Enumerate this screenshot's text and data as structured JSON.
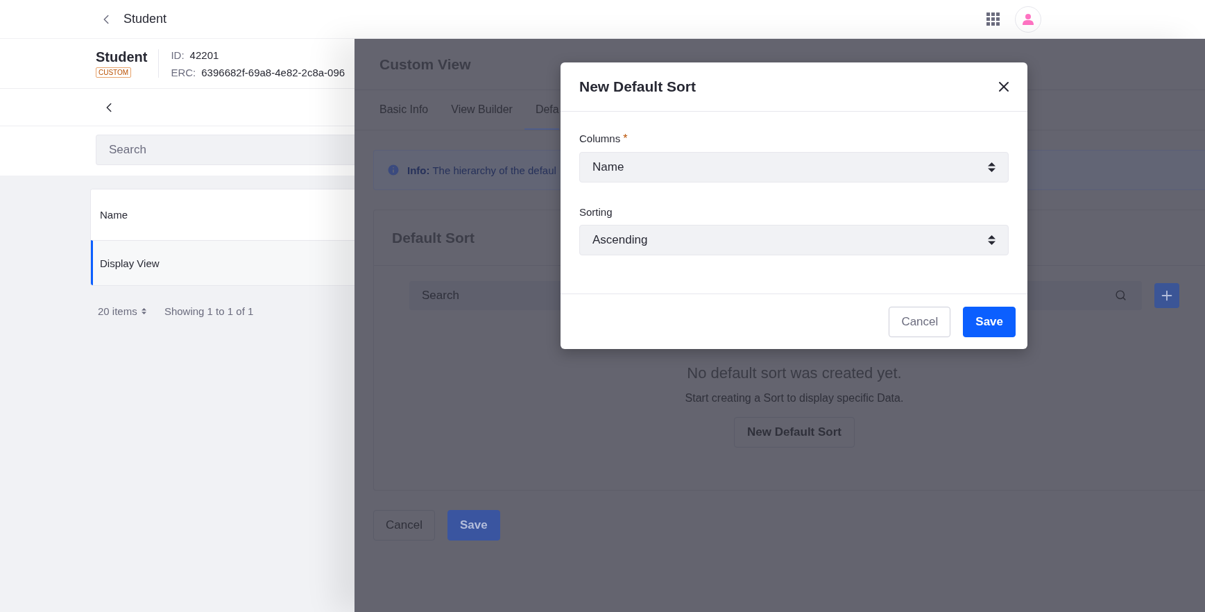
{
  "top_bar": {
    "title": "Student"
  },
  "object_header": {
    "title": "Student",
    "badge": "CUSTOM",
    "id_label": "ID:",
    "id_value": "42201",
    "erc_label": "ERC:",
    "erc_value": "6396682f-69a8-4e82-2c8a-096"
  },
  "sidebar": {
    "search": {
      "placeholder": "Search"
    },
    "rows": [
      {
        "label": "Name",
        "selected": false
      },
      {
        "label": "Display View",
        "selected": true
      }
    ],
    "pagination": {
      "page_size": "20 items",
      "summary": "Showing 1 to 1 of 1"
    }
  },
  "panel": {
    "title": "Custom View",
    "tabs": [
      {
        "label": "Basic Info",
        "selected": false
      },
      {
        "label": "View Builder",
        "selected": false
      },
      {
        "label": "Defa",
        "selected": true
      }
    ],
    "info": "**Info:** The hierarchy of the defaul",
    "card": {
      "title": "Default Sort",
      "search": {
        "placeholder": "Search"
      },
      "empty_title": "No default sort was created yet.",
      "empty_text": "Start creating a Sort to display specific Data.",
      "empty_button": "New Default Sort"
    },
    "buttons": [
      {
        "label": "Cancel",
        "kind": "secondary"
      },
      {
        "label": "Save",
        "kind": "primary"
      }
    ]
  },
  "modal": {
    "title": "New Default Sort",
    "fields": [
      {
        "label": "Columns",
        "required_mark": "*",
        "value": "Name"
      },
      {
        "label": "Sorting",
        "value": "Ascending"
      }
    ],
    "buttons": [
      {
        "label": "Cancel",
        "kind": "secondary"
      },
      {
        "label": "Save",
        "kind": "primary"
      }
    ]
  }
}
